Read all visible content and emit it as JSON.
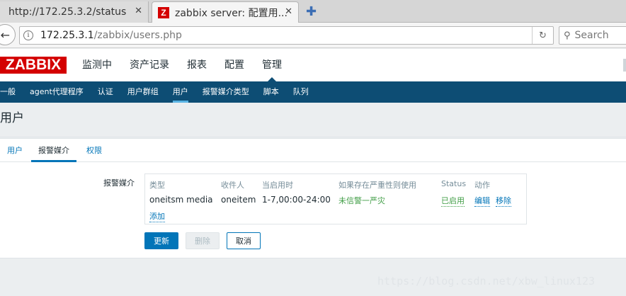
{
  "browser": {
    "tabs": [
      {
        "title": "http://172.25.3.2/status",
        "close": "✕"
      },
      {
        "title": "zabbix server: 配置用...",
        "close": "✕",
        "favicon": "Z"
      }
    ],
    "new_tab": "✚",
    "url_host": "172.25.3.1",
    "url_path": "/zabbix/users.php",
    "search_placeholder": "Search"
  },
  "zabbix": {
    "logo": "ZABBIX",
    "main_menu": [
      "监测中",
      "资产记录",
      "报表",
      "配置",
      "管理"
    ],
    "sub_menu": [
      "一般",
      "agent代理程序",
      "认证",
      "用户群组",
      "用户",
      "报警媒介类型",
      "脚本",
      "队列"
    ],
    "page_title": "用户",
    "tabs": [
      "用户",
      "报警媒介",
      "权限"
    ],
    "media_label": "报警媒介",
    "media_table": {
      "headers": [
        "类型",
        "收件人",
        "当启用时",
        "如果存在严重性则使用",
        "Status",
        "动作"
      ],
      "row": {
        "type": "oneitsm media",
        "sendto": "oneitem",
        "when": "1-7,00:00-24:00",
        "severity": "未信警一严灾",
        "status": "已启用",
        "edit": "编辑",
        "remove": "移除"
      },
      "add": "添加"
    },
    "buttons": {
      "update": "更新",
      "delete": "删除",
      "cancel": "取消"
    }
  },
  "watermark": "https://blog.csdn.net/xbw_linux123"
}
